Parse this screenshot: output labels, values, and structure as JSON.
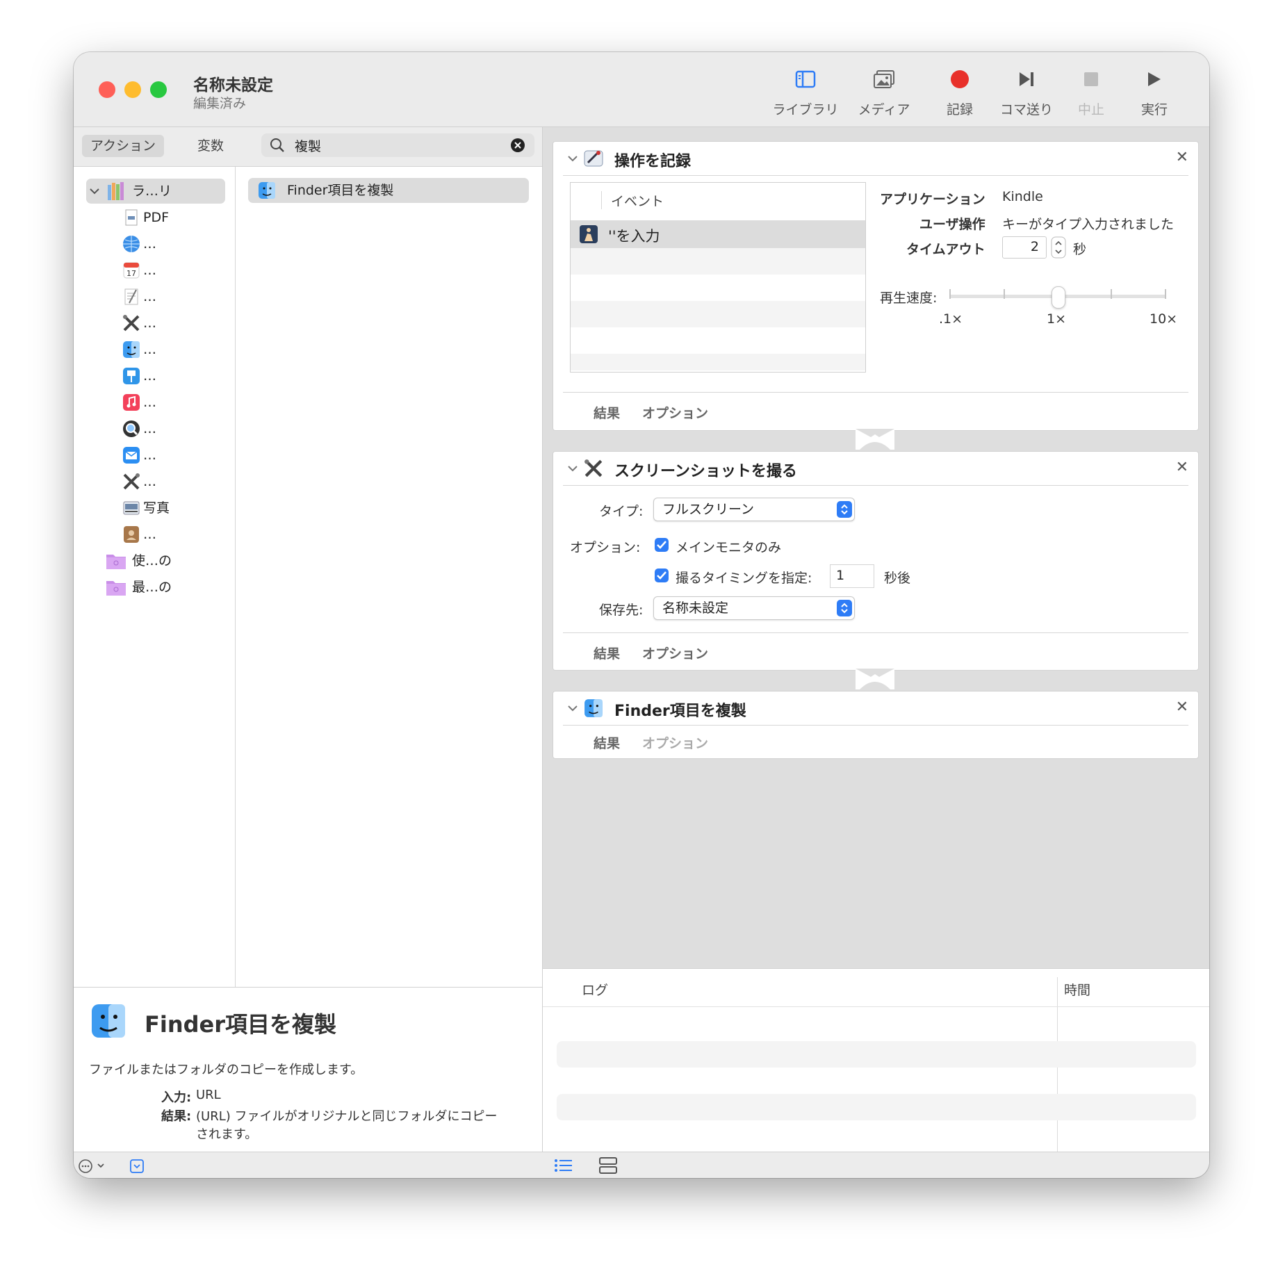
{
  "window": {
    "title": "名称未設定",
    "subtitle": "編集済み"
  },
  "toolbar": {
    "library": "ライブラリ",
    "media": "メディア",
    "record": "記録",
    "step": "コマ送り",
    "stop": "中止",
    "run": "実行",
    "record_color": "#e8302a"
  },
  "left": {
    "tab_actions": "アクション",
    "tab_variables": "変数",
    "search_value": "複製",
    "tree": [
      {
        "label": "ラ…リ",
        "icon": "library-icon"
      },
      {
        "label": "PDF",
        "icon": "pdf-icon"
      },
      {
        "label": "…",
        "icon": "internet-icon"
      },
      {
        "label": "…",
        "icon": "calendar-icon"
      },
      {
        "label": "…",
        "icon": "text-icon"
      },
      {
        "label": "…",
        "icon": "utilities-icon"
      },
      {
        "label": "…",
        "icon": "finder-icon"
      },
      {
        "label": "…",
        "icon": "presentation-icon"
      },
      {
        "label": "…",
        "icon": "music-icon"
      },
      {
        "label": "…",
        "icon": "spotlight-icon"
      },
      {
        "label": "…",
        "icon": "mail-icon"
      },
      {
        "label": "…",
        "icon": "tools-icon"
      },
      {
        "label": "写真",
        "icon": "photos-icon"
      },
      {
        "label": "…",
        "icon": "contacts-icon"
      },
      {
        "label": "使…の",
        "icon": "smart-folder-icon"
      },
      {
        "label": "最…の",
        "icon": "smart-folder-icon"
      }
    ],
    "result": "Finder項目を複製"
  },
  "description": {
    "title": "Finder項目を複製",
    "text": "ファイルまたはフォルダのコピーを作成します。",
    "input_label": "入力:",
    "input_value": "URL",
    "result_label": "結果:",
    "result_line1": "(URL) ファイルがオリジナルと同じフォルダにコピー",
    "result_line2": "されます。"
  },
  "card1": {
    "title": "操作を記録",
    "column": "イベント",
    "event": "''を入力",
    "app_label": "アプリケーション",
    "app_value": "Kindle",
    "user_label": "ユーザ操作",
    "user_value": "キーがタイプ入力されました",
    "timeout_label": "タイムアウト",
    "timeout_value": "2",
    "timeout_unit": "秒",
    "speed_label": "再生速度:",
    "speed_min": ".1×",
    "speed_mid": "1×",
    "speed_max": "10×",
    "results": "結果",
    "options": "オプション"
  },
  "card2": {
    "title": "スクリーンショットを撮る",
    "type_label": "タイプ:",
    "type_value": "フルスクリーン",
    "options_label": "オプション:",
    "main_monitor": "メインモニタのみ",
    "timing": "撮るタイミングを指定:",
    "timing_value": "1",
    "timing_unit": "秒後",
    "save_label": "保存先:",
    "save_value": "名称未設定",
    "results": "結果",
    "options": "オプション"
  },
  "card3": {
    "title": "Finder項目を複製",
    "results": "結果",
    "options": "オプション"
  },
  "log": {
    "col_log": "ログ",
    "col_time": "時間"
  }
}
